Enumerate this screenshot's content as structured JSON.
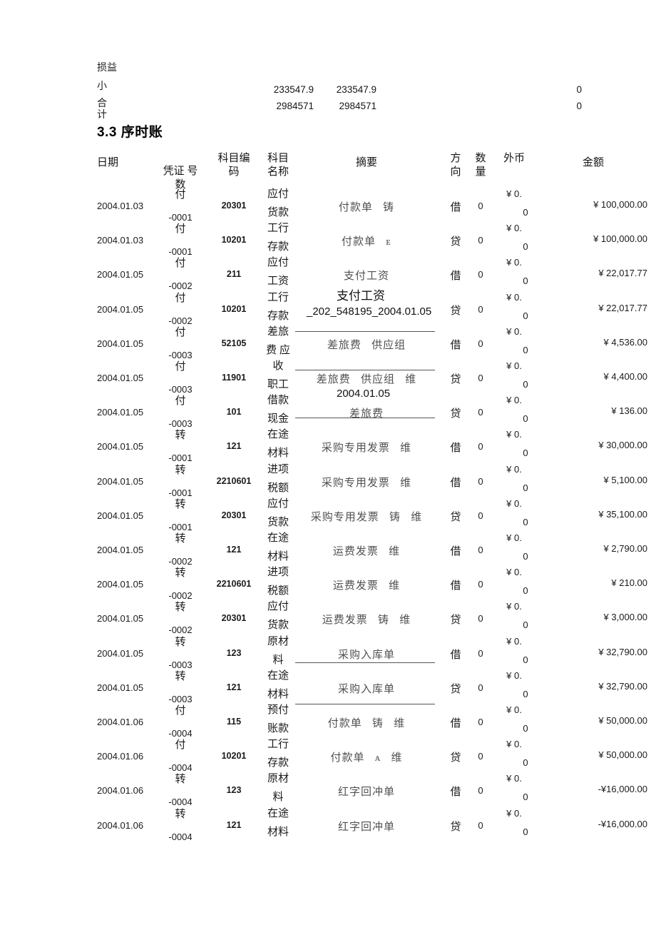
{
  "carry_over": {
    "rows": [
      {
        "label": "损益",
        "col1": "",
        "col2": "",
        "col3": ""
      },
      {
        "label": "小",
        "col1": "233547.9",
        "col2": "233547.9",
        "col3": "0"
      },
      {
        "label": "合",
        "col1": "2984571",
        "col2": "2984571",
        "col3": "0"
      },
      {
        "label": "计",
        "col1": "",
        "col2": "",
        "col3": ""
      }
    ]
  },
  "section": {
    "number": "3.3",
    "title": "序时账",
    "heading": "3.3 序时账"
  },
  "table": {
    "headers": {
      "date": "日期",
      "voucher": "凭证 号\n数",
      "code": "科目编\n码",
      "name": "科目\n名称",
      "summary": "摘要",
      "direction": "方\n向",
      "quantity": "数\n量",
      "foreign_currency": "外币",
      "amount": "金额"
    },
    "rows": [
      {
        "date": "2004.01.03",
        "voucher_prefix": "付",
        "voucher_suffix": "-0001",
        "code": "20301",
        "name_l1": "应付",
        "name_l2": "货款",
        "summary": "付款单   铸",
        "direction": "借",
        "quantity": "0",
        "fc_l1": "¥ 0.",
        "fc_l2": "0",
        "amount": "¥ 100,000.00"
      },
      {
        "date": "2004.01.03",
        "voucher_prefix": "付",
        "voucher_suffix": "-0001",
        "code": "10201",
        "name_l1": "工行",
        "name_l2": "存款",
        "summary": "付款单   ᴇ",
        "direction": "贷",
        "quantity": "0",
        "fc_l1": "¥ 0.",
        "fc_l2": "0",
        "amount": "¥ 100,000.00"
      },
      {
        "date": "2004.01.05",
        "voucher_prefix": "付",
        "voucher_suffix": "-0002",
        "code": "211",
        "name_l1": "应付",
        "name_l2": "工资",
        "summary": "支付工资",
        "direction": "借",
        "quantity": "0",
        "fc_l1": "¥ 0.",
        "fc_l2": "0",
        "amount": "¥ 22,017.77"
      },
      {
        "date": "2004.01.05",
        "voucher_prefix": "付",
        "voucher_suffix": "-0002",
        "code": "10201",
        "name_l1": "工行",
        "name_l2": "存款",
        "summary": "",
        "direction": "贷",
        "quantity": "0",
        "fc_l1": "¥ 0.",
        "fc_l2": "0",
        "amount": "¥ 22,017.77"
      },
      {
        "date": "2004.01.05",
        "voucher_prefix": "付",
        "voucher_suffix": "-0003",
        "code": "52105",
        "name_l1": "差旅",
        "name_l2": "费 应",
        "summary": "差旅费   供应组",
        "direction": "借",
        "quantity": "0",
        "fc_l1": "¥ 0.",
        "fc_l2": "0",
        "amount": "¥ 4,536.00"
      },
      {
        "date": "2004.01.05",
        "voucher_prefix": "付",
        "voucher_suffix": "-0003",
        "code": "11901",
        "name_l1": "收",
        "name_l2": "职工",
        "summary": "差旅费   供应组   维",
        "direction": "贷",
        "quantity": "0",
        "fc_l1": "¥ 0.",
        "fc_l2": "0",
        "amount": "¥ 4,400.00"
      },
      {
        "date": "2004.01.05",
        "voucher_prefix": "付",
        "voucher_suffix": "-0003",
        "code": "101",
        "name_l1": "借款",
        "name_l2": "现金",
        "summary": "差旅费",
        "direction": "贷",
        "quantity": "0",
        "fc_l1": "¥ 0.",
        "fc_l2": "0",
        "amount": "¥ 136.00"
      },
      {
        "date": "2004.01.05",
        "voucher_prefix": "转",
        "voucher_suffix": "-0001",
        "code": "121",
        "name_l1": "在途",
        "name_l2": "材料",
        "summary": "采购专用发票   维",
        "direction": "借",
        "quantity": "0",
        "fc_l1": "¥ 0.",
        "fc_l2": "0",
        "amount": "¥ 30,000.00"
      },
      {
        "date": "2004.01.05",
        "voucher_prefix": "转",
        "voucher_suffix": "-0001",
        "code": "2210601",
        "name_l1": "进项",
        "name_l2": "税额",
        "summary": "采购专用发票   维",
        "direction": "借",
        "quantity": "0",
        "fc_l1": "¥ 0.",
        "fc_l2": "0",
        "amount": "¥ 5,100.00"
      },
      {
        "date": "2004.01.05",
        "voucher_prefix": "转",
        "voucher_suffix": "-0001",
        "code": "20301",
        "name_l1": "应付",
        "name_l2": "货款",
        "summary": "采购专用发票   铸   维",
        "direction": "贷",
        "quantity": "0",
        "fc_l1": "¥ 0.",
        "fc_l2": "0",
        "amount": "¥ 35,100.00"
      },
      {
        "date": "2004.01.05",
        "voucher_prefix": "转",
        "voucher_suffix": "-0002",
        "code": "121",
        "name_l1": "在途",
        "name_l2": "材料",
        "summary": "运费发票   维",
        "direction": "借",
        "quantity": "0",
        "fc_l1": "¥ 0.",
        "fc_l2": "0",
        "amount": "¥ 2,790.00"
      },
      {
        "date": "2004.01.05",
        "voucher_prefix": "转",
        "voucher_suffix": "-0002",
        "code": "2210601",
        "name_l1": "进项",
        "name_l2": "税额",
        "summary": "运费发票   维",
        "direction": "借",
        "quantity": "0",
        "fc_l1": "¥ 0.",
        "fc_l2": "0",
        "amount": "¥ 210.00"
      },
      {
        "date": "2004.01.05",
        "voucher_prefix": "转",
        "voucher_suffix": "-0002",
        "code": "20301",
        "name_l1": "应付",
        "name_l2": "货款",
        "summary": "运费发票   铸   维",
        "direction": "贷",
        "quantity": "0",
        "fc_l1": "¥ 0.",
        "fc_l2": "0",
        "amount": "¥ 3,000.00"
      },
      {
        "date": "2004.01.05",
        "voucher_prefix": "转",
        "voucher_suffix": "-0003",
        "code": "123",
        "name_l1": "原材",
        "name_l2": "料",
        "summary": "采购入库单",
        "direction": "借",
        "quantity": "0",
        "fc_l1": "¥ 0.",
        "fc_l2": "0",
        "amount": "¥ 32,790.00"
      },
      {
        "date": "2004.01.05",
        "voucher_prefix": "转",
        "voucher_suffix": "-0003",
        "code": "121",
        "name_l1": "在途",
        "name_l2": "材料",
        "summary": "采购入库单",
        "direction": "贷",
        "quantity": "0",
        "fc_l1": "¥ 0.",
        "fc_l2": "0",
        "amount": "¥ 32,790.00"
      },
      {
        "date": "2004.01.06",
        "voucher_prefix": "付",
        "voucher_suffix": "-0004",
        "code": "115",
        "name_l1": "预付",
        "name_l2": "账款",
        "summary": "付款单   铸   维",
        "direction": "借",
        "quantity": "0",
        "fc_l1": "¥ 0.",
        "fc_l2": "0",
        "amount": "¥ 50,000.00"
      },
      {
        "date": "2004.01.06",
        "voucher_prefix": "付",
        "voucher_suffix": "-0004",
        "code": "10201",
        "name_l1": "工行",
        "name_l2": "存款",
        "summary": "付款单   ᴀ   维",
        "direction": "贷",
        "quantity": "0",
        "fc_l1": "¥ 0.",
        "fc_l2": "0",
        "amount": "¥ 50,000.00"
      },
      {
        "date": "2004.01.06",
        "voucher_prefix": "转",
        "voucher_suffix": "-0004",
        "code": "123",
        "name_l1": "原材",
        "name_l2": "料",
        "summary": "红字回冲单",
        "direction": "借",
        "quantity": "0",
        "fc_l1": "¥ 0.",
        "fc_l2": "0",
        "amount": "-¥16,000.00"
      },
      {
        "date": "2004.01.06",
        "voucher_prefix": "转",
        "voucher_suffix": "-0004",
        "code": "121",
        "name_l1": "在途",
        "name_l2": "材料",
        "summary": "红字回冲单",
        "direction": "贷",
        "quantity": "0",
        "fc_l1": "¥ 0.",
        "fc_l2": "0",
        "amount": "-¥16,000.00"
      }
    ]
  },
  "annotations": {
    "note_salary": "支付工资",
    "note_ref": "_202_548195_2004.01.05",
    "note_date": "2004.01.05"
  }
}
